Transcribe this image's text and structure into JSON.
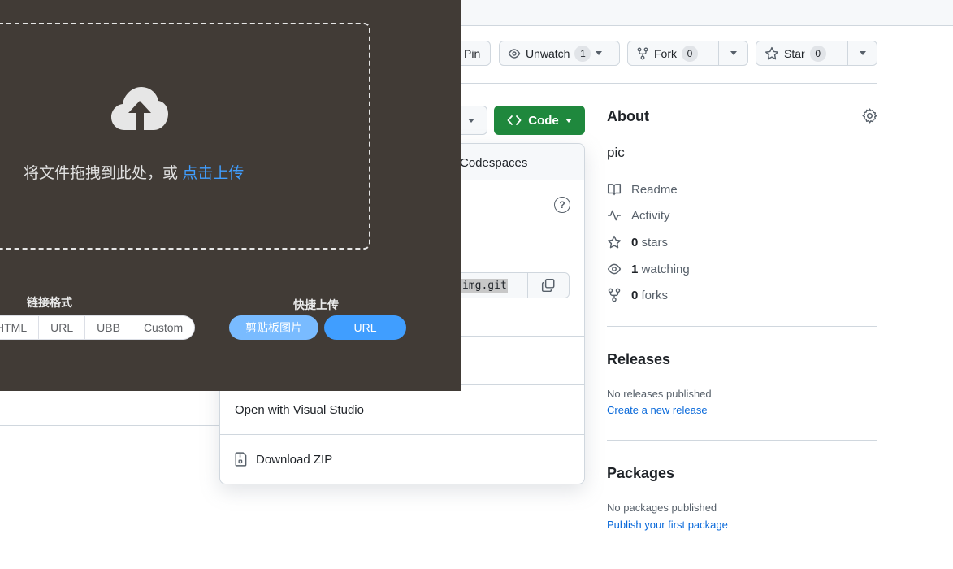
{
  "header": {
    "pin_label": "Pin",
    "unwatch_label": "Unwatch",
    "unwatch_count": "1",
    "fork_label": "Fork",
    "fork_count": "0",
    "star_label": "Star",
    "star_count": "0"
  },
  "code_button": {
    "label": "Code"
  },
  "code_dropdown": {
    "codespaces_tab": "Codespaces",
    "clone_url": "img.git",
    "help_icon": "?",
    "open_visual_studio": "Open with Visual Studio",
    "download_zip": "Download ZIP"
  },
  "about": {
    "title": "About",
    "description": "pic",
    "readme": "Readme",
    "activity": "Activity",
    "stars_count": "0",
    "stars_label": "stars",
    "watching_count": "1",
    "watching_label": "watching",
    "forks_count": "0",
    "forks_label": "forks"
  },
  "releases": {
    "title": "Releases",
    "none_text": "No releases published",
    "create_link": "Create a new release"
  },
  "packages": {
    "title": "Packages",
    "none_text": "No packages published",
    "publish_link": "Publish your first package"
  },
  "upload_overlay": {
    "drop_text": "将文件拖拽到此处，或 ",
    "click_upload": "点击上传",
    "link_format_label": "链接格式",
    "link_formats": [
      "HTML",
      "URL",
      "UBB",
      "Custom"
    ],
    "quick_upload_label": "快捷上传",
    "clipboard_button": "剪贴板图片",
    "url_button": "URL"
  },
  "colors": {
    "overlay_bg": "#413b36",
    "accent_blue": "#409eff",
    "github_green": "#1f883d",
    "link_blue": "#0969da"
  }
}
